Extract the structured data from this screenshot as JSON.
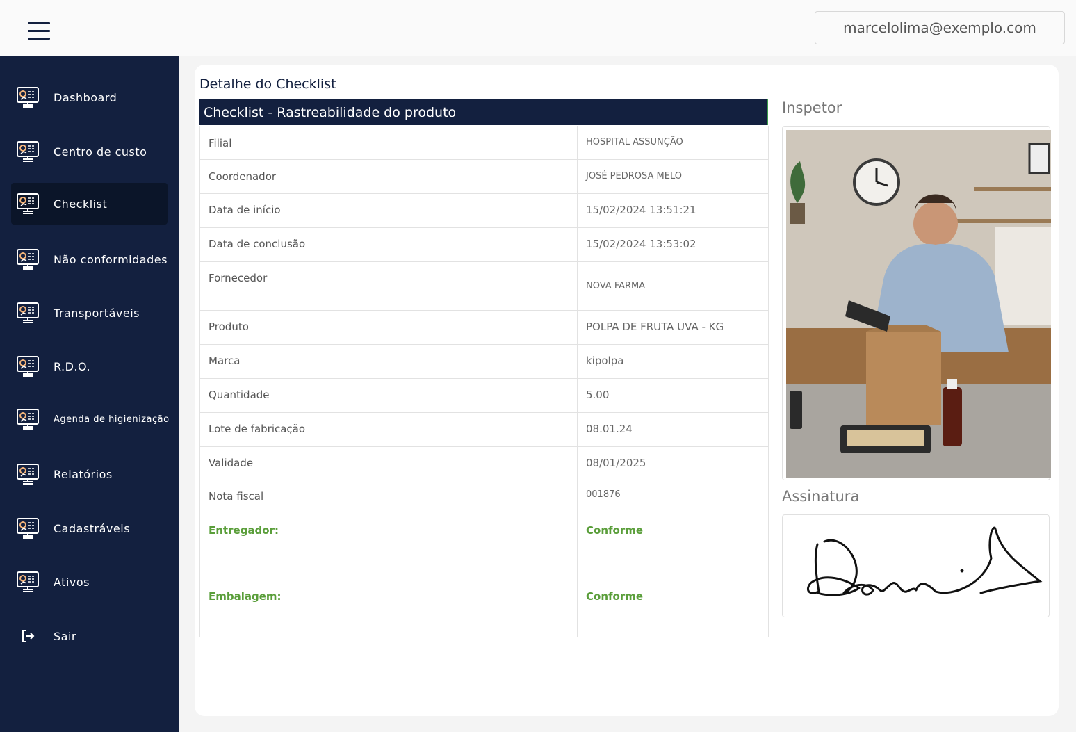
{
  "header": {
    "menu_icon": "hamburger-menu-icon",
    "user_email": "marcelolima@exemplo.com"
  },
  "sidebar": {
    "items": [
      {
        "label": "Dashboard",
        "icon": "monitor-chart-icon"
      },
      {
        "label": "Centro de custo",
        "icon": "monitor-chart-icon"
      },
      {
        "label": "Checklist",
        "icon": "monitor-chart-icon",
        "active": true
      },
      {
        "label": "Não conformidades",
        "icon": "monitor-chart-icon"
      },
      {
        "label": "Transportáveis",
        "icon": "monitor-chart-icon"
      },
      {
        "label": "R.D.O.",
        "icon": "monitor-chart-icon"
      },
      {
        "label": "Agenda de higienização",
        "icon": "monitor-chart-icon"
      },
      {
        "label": "Relatórios",
        "icon": "monitor-chart-icon"
      },
      {
        "label": "Cadastráveis",
        "icon": "monitor-chart-icon"
      },
      {
        "label": "Ativos",
        "icon": "monitor-chart-icon"
      }
    ],
    "logout": {
      "label": "Sair",
      "icon": "logout-icon"
    }
  },
  "main": {
    "title": "Detalhe do Checklist",
    "checklist_title": "Checklist - Rastreabilidade do produto",
    "rows": [
      {
        "label": "Filial",
        "value": "HOSPITAL ASSUNÇÃO"
      },
      {
        "label": "Coordenador",
        "value": "JOSÉ PEDROSA MELO"
      },
      {
        "label": "Data de início",
        "value": "15/02/2024 13:51:21"
      },
      {
        "label": "Data de conclusão",
        "value": "15/02/2024 13:53:02"
      },
      {
        "label": "Fornecedor",
        "value": "NOVA FARMA"
      },
      {
        "label": "Produto",
        "value": "POLPA DE FRUTA UVA - KG"
      },
      {
        "label": "Marca",
        "value": "kipolpa"
      },
      {
        "label": "Quantidade",
        "value": "5.00"
      },
      {
        "label": "Lote de fabricação",
        "value": "08.01.24"
      },
      {
        "label": "Validade",
        "value": "08/01/2025"
      },
      {
        "label": "Nota fiscal",
        "value": "001876"
      }
    ],
    "checks": [
      {
        "label": "Entregador:",
        "value": "Conforme"
      },
      {
        "label": "Embalagem:",
        "value": "Conforme"
      }
    ],
    "inspector_title": "Inspetor",
    "signature_title": "Assinatura"
  },
  "colors": {
    "navy": "#13203f",
    "conforme_green": "#5a9e3a"
  }
}
